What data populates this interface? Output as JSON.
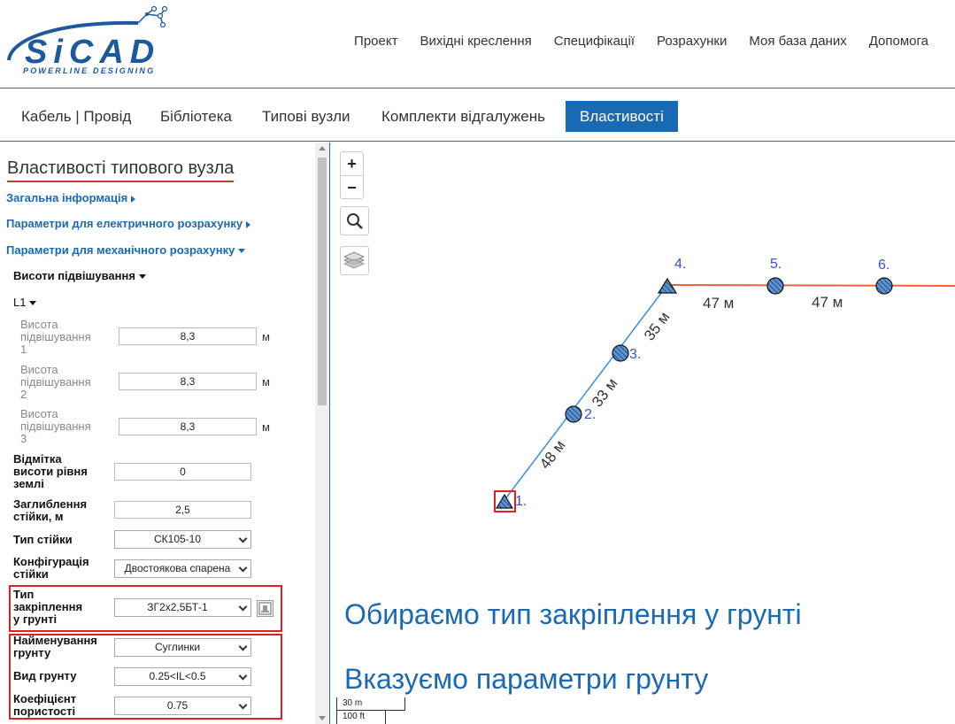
{
  "header": {
    "logo_text": "SiCAD",
    "logo_tagline": "POWERLINE DESIGNING",
    "nav": [
      "Проект",
      "Вихідні креслення",
      "Специфікації",
      "Розрахунки",
      "Моя база даних",
      "Допомога"
    ]
  },
  "tabs": [
    "Кабель | Провід",
    "Бібліотека",
    "Типові вузли",
    "Комплекти відгалужень",
    "Властивості"
  ],
  "active_tab": "Властивості",
  "panel": {
    "title": "Властивості типового вузла",
    "sections": {
      "general": "Загальна інформація",
      "electrical": "Параметри для електричного розрахунку",
      "mechanical": "Параметри для механічного розрахунку"
    },
    "heights_header": "Висоти підвішування",
    "line_label": "L1",
    "heights": [
      {
        "label_1": "Висота",
        "label_2": "підвішування",
        "label_3": "1",
        "value": "8,3",
        "unit": "м"
      },
      {
        "label_1": "Висота",
        "label_2": "підвішування",
        "label_3": "2",
        "value": "8,3",
        "unit": "м"
      },
      {
        "label_1": "Висота",
        "label_2": "підвішування",
        "label_3": "3",
        "value": "8,3",
        "unit": "м"
      }
    ],
    "ground_level": {
      "label_1": "Відмітка",
      "label_2": "висоти рівня",
      "label_3": "землі",
      "value": "0"
    },
    "pole_depth": {
      "label_1": "Заглиблення",
      "label_2": "стійки, м",
      "value": "2,5"
    },
    "pole_type": {
      "label": "Тип стійки",
      "value": "СК105-10"
    },
    "pole_config": {
      "label_1": "Конфігурація",
      "label_2": "стійки",
      "value": "Двостоякова спарена"
    },
    "anchor_type": {
      "label_1": "Тип",
      "label_2": "закріплення",
      "label_3": "у грунті",
      "value": "ЗГ2х2,5БТ-1"
    },
    "soil_name": {
      "label_1": "Найменування",
      "label_2": "грунту",
      "value": "Суглинки"
    },
    "soil_kind": {
      "label": "Вид грунту",
      "value": "0.25<IL<0.5"
    },
    "porosity": {
      "label_1": "Коефіцієнт",
      "label_2": "пористості",
      "value": "0.75"
    }
  },
  "map": {
    "zoom_in": "+",
    "zoom_out": "−",
    "nodes": [
      "1.",
      "2.",
      "3.",
      "4.",
      "5.",
      "6."
    ],
    "spans": [
      "48 м",
      "33 м",
      "35 м",
      "47 м",
      "47 м"
    ],
    "annotation_1": "Обираємо тип закріплення у грунті",
    "annotation_2": "Вказуємо параметри грунту",
    "scale_metric": "30 m",
    "scale_imperial": "100 ft",
    "colors": {
      "branch_line": "#3b8de0",
      "main_line": "#e8643a",
      "node_fill": "#4a8ccc",
      "label": "#3b4fc8"
    }
  }
}
